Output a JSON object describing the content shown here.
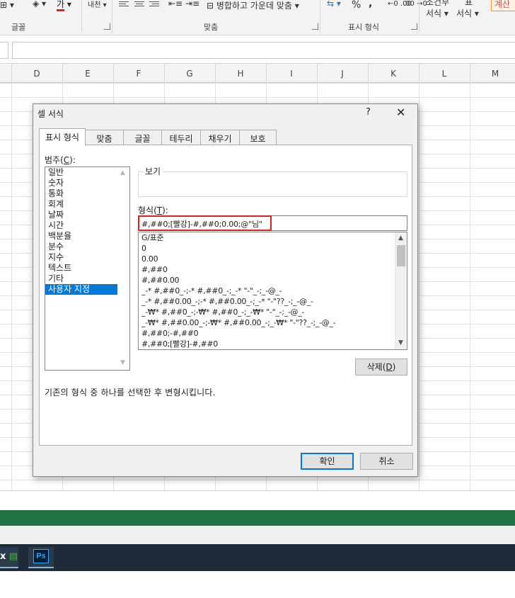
{
  "ribbon": {
    "font_color_char": "가",
    "merge_center_label": "병합하고 가운데 맞춤",
    "percent": "%",
    "comma": ",",
    "cond_format_line1": "조건부",
    "cond_format_line2": "서식",
    "table_line1": "표",
    "table_line2": "서식",
    "cell_style": "계산",
    "groups": {
      "font": "글꼴",
      "alignment": "맞춤",
      "number": "표시 형식"
    }
  },
  "columns": [
    "D",
    "E",
    "F",
    "G",
    "H",
    "I",
    "J",
    "K",
    "L",
    "M"
  ],
  "dialog": {
    "title": "셀 서식",
    "help": "?",
    "close": "✕",
    "tabs": [
      "표시 형식",
      "맞춤",
      "글꼴",
      "테두리",
      "채우기",
      "보호"
    ],
    "active_tab": "표시 형식",
    "category_label": "범주(",
    "category_label_key": "C",
    "category_label_end": "):",
    "categories": [
      "일반",
      "숫자",
      "통화",
      "회계",
      "날짜",
      "시간",
      "백분율",
      "분수",
      "지수",
      "텍스트",
      "기타",
      "사용자 지정"
    ],
    "selected_category": "사용자 지정",
    "preview_label": "보기",
    "format_label": "형식(",
    "format_label_key": "T",
    "format_label_end": "):",
    "format_value": "#,##0;[빨강]-#,##0;0.00;@\"님\"",
    "formats": [
      "G/표준",
      "0",
      "0.00",
      "#,##0",
      "#,##0.00",
      "_-* #,##0_-;-* #,##0_-;_-* \"-\"_-;_-@_-",
      "_-* #,##0.00_-;-* #,##0.00_-;_-* \"-\"??_-;_-@_-",
      "_-₩* #,##0_-;-₩* #,##0_-;_-₩* \"-\"_-;_-@_-",
      "_-₩* #,##0.00_-;-₩* #,##0.00_-;_-₩* \"-\"??_-;_-@_-",
      "#,##0;-#,##0",
      "#,##0;[빨강]-#,##0"
    ],
    "delete_button": "삭제(",
    "delete_button_key": "D",
    "delete_button_end": ")",
    "description": "기존의 형식 중 하나를 선택한 후 변형시킵니다.",
    "ok_button": "확인",
    "cancel_button": "취소"
  },
  "taskbar": {
    "excel_label": "x",
    "ps_label": "Ps"
  },
  "colors": {
    "accent": "#0078d7",
    "excel_green": "#217346",
    "highlight": "#e02020"
  }
}
